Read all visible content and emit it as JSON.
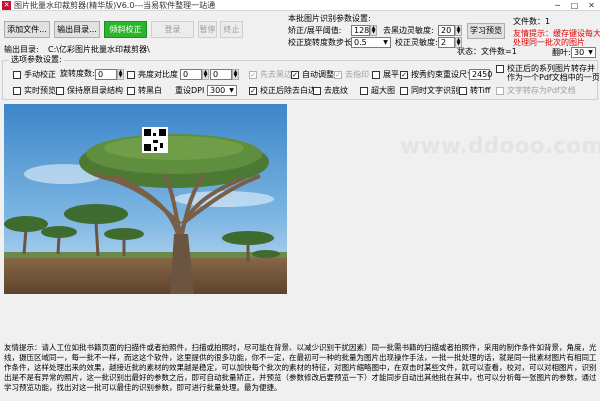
{
  "window": {
    "title": "图片批量水印裁剪器(精华版)V6.0---当易软件整理一站通",
    "minimize": "─",
    "maximize": "□",
    "close": "✕"
  },
  "toolbar": {
    "add_file": "添加文件...",
    "output_dir": "输出目录...",
    "correct": "倾斜校正",
    "login": "登录",
    "pause": "暂停",
    "stop": "终止"
  },
  "params": {
    "title": "本批图片识别参数设置:",
    "threshold_label": "矫正/展平阈值:",
    "threshold_value": "128",
    "rotate_step_label": "校正旋转度数步长:",
    "rotate_step_value": "0.5",
    "black_edge_label": "去黑边灵敏度:",
    "black_edge_value": "20",
    "correct_sens_label": "校正灵敏度:",
    "correct_sens_value": "2",
    "learn_preview": "学习预览"
  },
  "right_info": {
    "file_count": "文件数：1",
    "tip1": "友情提示：缓存键设每大",
    "tip2": "处理同一批次的图片",
    "page_label": "翻叶:",
    "page_value": "30"
  },
  "output": {
    "label": "输出目录:",
    "path": "C:\\亿彩图片批量水印裁剪器\\"
  },
  "status": "状态：文件数=1",
  "options": {
    "legend": "选项参数设置:",
    "manual_correct": "手动校正",
    "rotate_deg_label": "旋转度数:",
    "rotate_deg_value": "0",
    "brightness_label": "亮度对比度",
    "brightness_value1": "0",
    "brightness_value2": "0",
    "black_first": "先去黑边",
    "auto_adjust": "自动调整",
    "remove_print": "去指印",
    "flatten": "展平",
    "constraint_size": "按秀约束重设尺寸",
    "constraint_value": "2450",
    "merge_note": "校正后的系列图片转存并作为一个Pdf文档中的一页",
    "realtime_preview": "实时预览",
    "keep_dir": "保持原目录结构",
    "convert_bw": "转黑白",
    "resample_label": "重设DPI",
    "resample_value": "300",
    "remove_edge_after": "校正后除去白边",
    "remove_bottom": "去底纹",
    "super_big": "超大图",
    "ocr_sync": "同时文字识别",
    "to_tiff": "转Tiff",
    "save_pdf": "文字转存为Pdf文档"
  },
  "preview": {
    "watermark": "www.ddooo.com"
  },
  "footer_note": "友情提示：请人工位如批书籍页面的扫描件或者拍照件，扫描或拍照时，尽可能在背景、以减少识别干扰因素）同一批需书籍的扫描或者拍照件，采用的制作条件如背景，角度，光线，摄压区域同一，每一批不一样，而这这个软件，这里提供的很多功能，你不一定，在最初可一种的批量为图片出现操作手法，一批一批处理的话，就是同一批素材图片有相同工作条件，这样处理出来的效果，越接近批的素材的效果越是稳定，可以加快每个批次的素材的特征，对图片缩略图中，在双击时某些文件，就可以查看，校对，可以对相图片，识别出是不是有异常的照片，这一批识别出最好的参数之后，即可自动批量矫正，并预览（参数修改后要预览一下）才能同步自动出其他批在其中，也可以分析每一张图片的参数，通过学习预览功能，找出对这一批可以最佳的识别参数，即可进行批量处理。最为便捷。"
}
